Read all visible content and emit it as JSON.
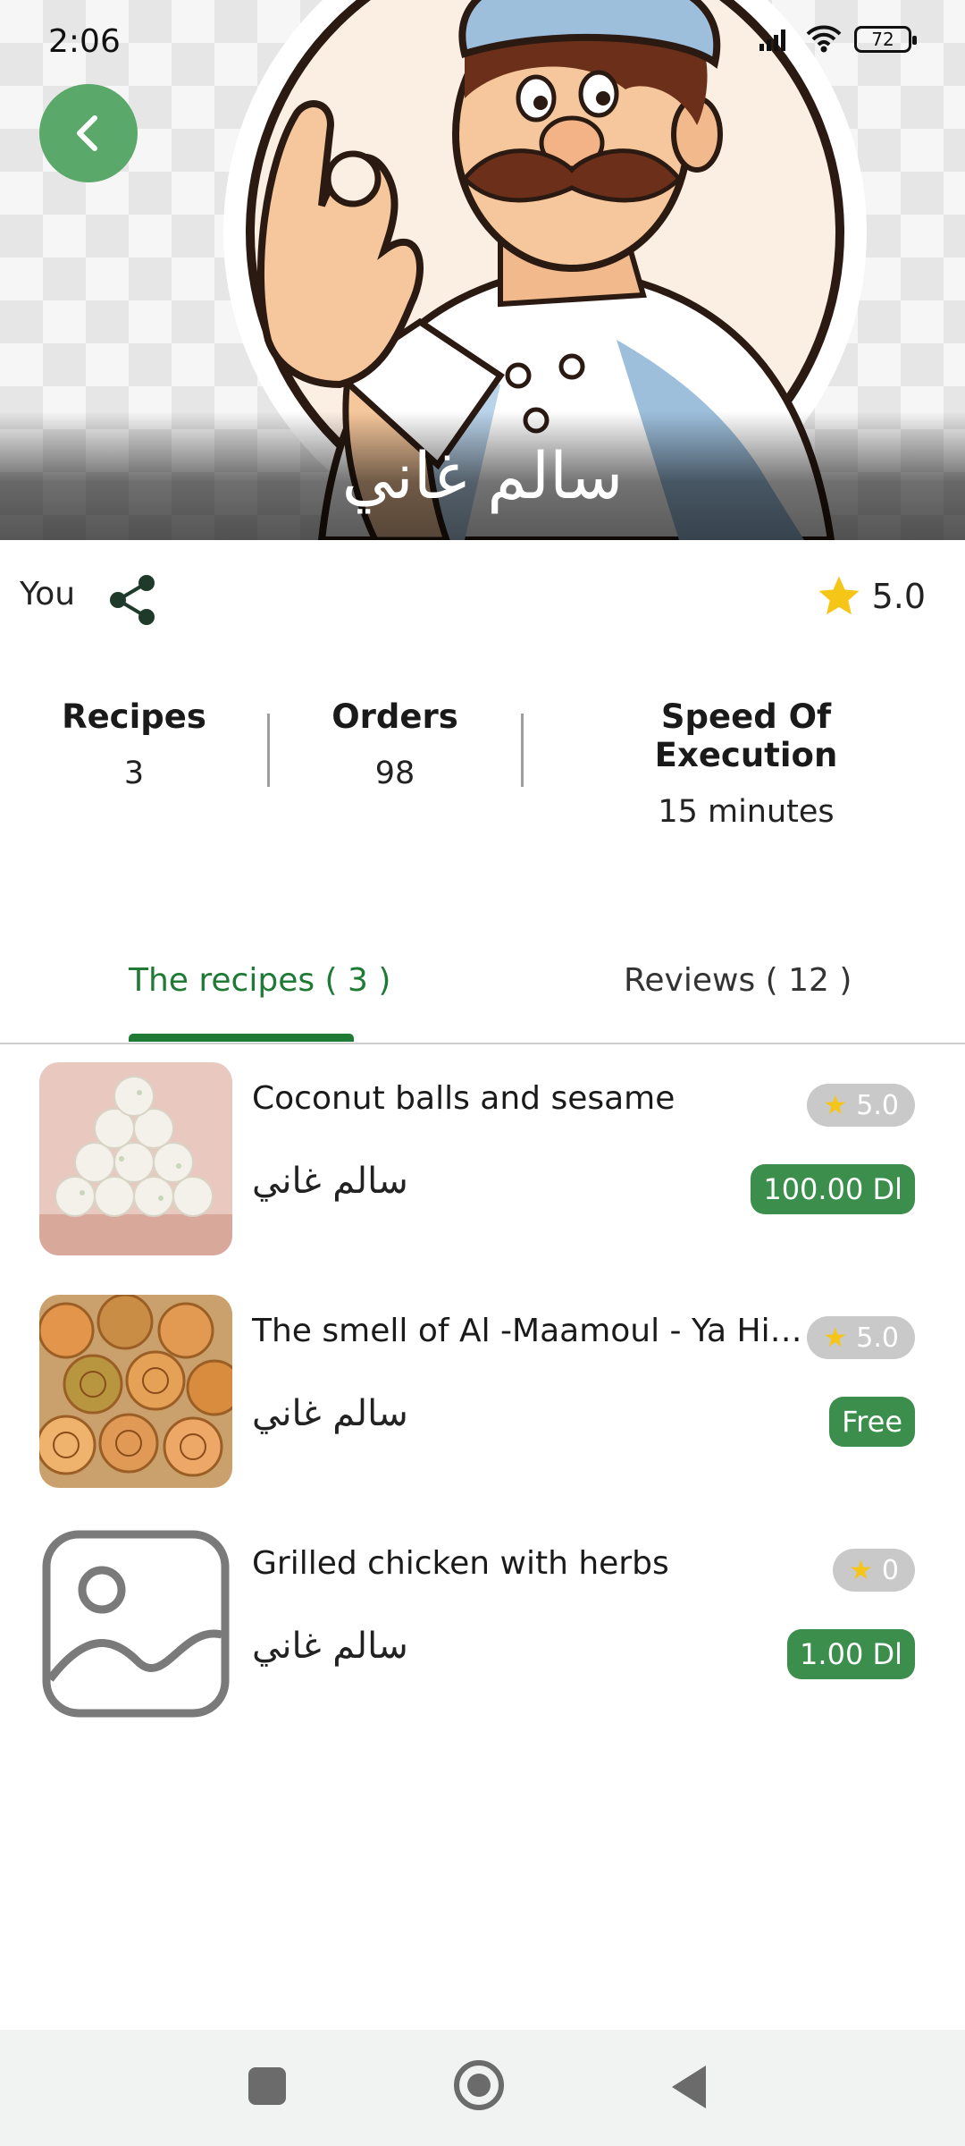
{
  "status_bar": {
    "time": "2:06",
    "battery": "72"
  },
  "hero": {
    "chef_name": "سالم غاني"
  },
  "owner": {
    "label": "You",
    "rating": "5.0"
  },
  "stats": [
    {
      "label": "Recipes",
      "value": "3"
    },
    {
      "label": "Orders",
      "value": "98"
    },
    {
      "label": "Speed Of Execution",
      "value": "15 minutes"
    }
  ],
  "tabs": [
    {
      "label": "The recipes ( 3 )",
      "active": true
    },
    {
      "label": "Reviews ( 12 )",
      "active": false
    }
  ],
  "recipes": [
    {
      "title": "Coconut balls and sesame",
      "author": "سالم غاني",
      "rating": "5.0",
      "price": "100.00 Dl"
    },
    {
      "title": "The smell of Al -Maamoul - Ya Hila ...",
      "author": "سالم غاني",
      "rating": "5.0",
      "price": "Free"
    },
    {
      "title": "Grilled chicken with herbs",
      "author": "سالم غاني",
      "rating": "0",
      "price": "1.00 Dl"
    }
  ],
  "colors": {
    "accent_green": "#1e7a35",
    "price_green": "#3b8e4c",
    "star": "#f5c518"
  }
}
